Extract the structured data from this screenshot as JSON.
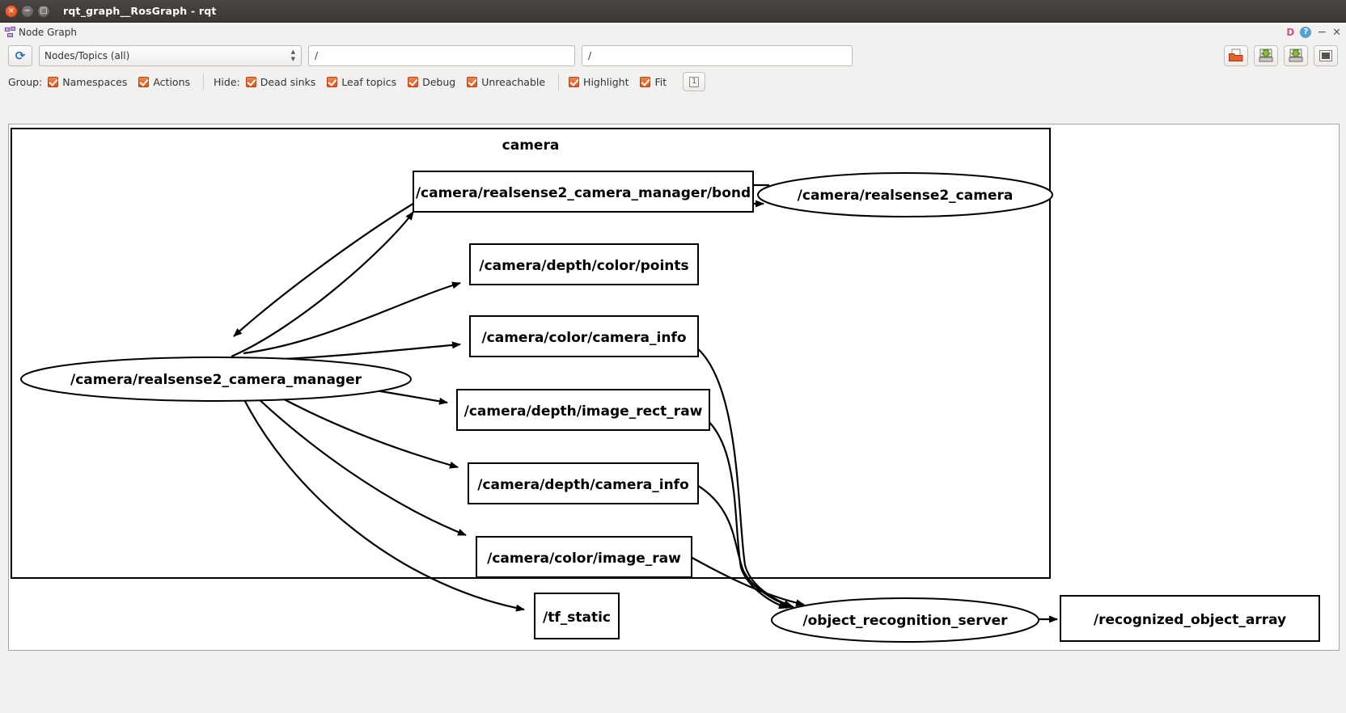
{
  "window": {
    "title": "rqt_graph__RosGraph - rqt",
    "close_glyph": "×",
    "minimize_glyph": "−",
    "maximize_glyph": "□"
  },
  "plugin_header": {
    "title": "Node Graph",
    "icon": "node-graph-icon",
    "help_glyph": "?",
    "dock_glyph": "D",
    "minimize_glyph": "−",
    "close_glyph": "✕"
  },
  "toolbar": {
    "refresh_glyph": "⟳",
    "filter_mode": "Nodes/Topics (all)",
    "topic_filter_value": "/",
    "node_filter_value": "/",
    "buttons": [
      {
        "name": "load-dot-button",
        "icon": "folder-open-icon"
      },
      {
        "name": "save-dot-button",
        "icon": "save-dot-icon"
      },
      {
        "name": "save-as-svg-button",
        "icon": "save-svg-icon"
      },
      {
        "name": "save-as-image-button",
        "icon": "image-icon"
      }
    ]
  },
  "options": {
    "group_label": "Group:",
    "group_items": [
      {
        "label": "Namespaces",
        "checked": true
      },
      {
        "label": "Actions",
        "checked": true
      }
    ],
    "hide_label": "Hide:",
    "hide_items": [
      {
        "label": "Dead sinks",
        "checked": true
      },
      {
        "label": "Leaf topics",
        "checked": true
      },
      {
        "label": "Debug",
        "checked": true
      },
      {
        "label": "Unreachable",
        "checked": true
      }
    ],
    "view_items": [
      {
        "label": "Highlight",
        "checked": true
      },
      {
        "label": "Fit",
        "checked": true
      }
    ],
    "zoom_badge": "1"
  },
  "graph": {
    "namespace_label": "camera",
    "nodes": [
      {
        "id": "n_mgr",
        "label": "/camera/realsense2_camera_manager",
        "shape": "ellipse"
      },
      {
        "id": "n_cam",
        "label": "/camera/realsense2_camera",
        "shape": "ellipse"
      },
      {
        "id": "n_objrec",
        "label": "/object_recognition_server",
        "shape": "ellipse"
      },
      {
        "id": "t_bond",
        "label": "/camera/realsense2_camera_manager/bond",
        "shape": "box"
      },
      {
        "id": "t_points",
        "label": "/camera/depth/color/points",
        "shape": "box"
      },
      {
        "id": "t_ccinfo",
        "label": "/camera/color/camera_info",
        "shape": "box"
      },
      {
        "id": "t_drect",
        "label": "/camera/depth/image_rect_raw",
        "shape": "box"
      },
      {
        "id": "t_dcinfo",
        "label": "/camera/depth/camera_info",
        "shape": "box"
      },
      {
        "id": "t_craw",
        "label": "/camera/color/image_raw",
        "shape": "box"
      },
      {
        "id": "t_tf",
        "label": "/tf_static",
        "shape": "box"
      },
      {
        "id": "t_roa",
        "label": "/recognized_object_array",
        "shape": "box"
      }
    ],
    "edges": [
      {
        "from": "n_mgr",
        "to": "t_bond"
      },
      {
        "from": "t_bond",
        "to": "n_mgr"
      },
      {
        "from": "t_bond",
        "to": "n_cam"
      },
      {
        "from": "n_cam",
        "to": "t_bond"
      },
      {
        "from": "n_mgr",
        "to": "t_points"
      },
      {
        "from": "n_mgr",
        "to": "t_ccinfo"
      },
      {
        "from": "n_mgr",
        "to": "t_drect"
      },
      {
        "from": "n_mgr",
        "to": "t_dcinfo"
      },
      {
        "from": "n_mgr",
        "to": "t_craw"
      },
      {
        "from": "n_mgr",
        "to": "t_tf"
      },
      {
        "from": "t_ccinfo",
        "to": "n_objrec"
      },
      {
        "from": "t_drect",
        "to": "n_objrec"
      },
      {
        "from": "t_dcinfo",
        "to": "n_objrec"
      },
      {
        "from": "t_craw",
        "to": "n_objrec"
      },
      {
        "from": "n_objrec",
        "to": "t_roa"
      }
    ]
  },
  "colors": {
    "accent": "#e2561d",
    "titlebar": "#3b3735",
    "background": "#f2f1f0",
    "canvas": "#ffffff",
    "graph_stroke": "#000000"
  }
}
